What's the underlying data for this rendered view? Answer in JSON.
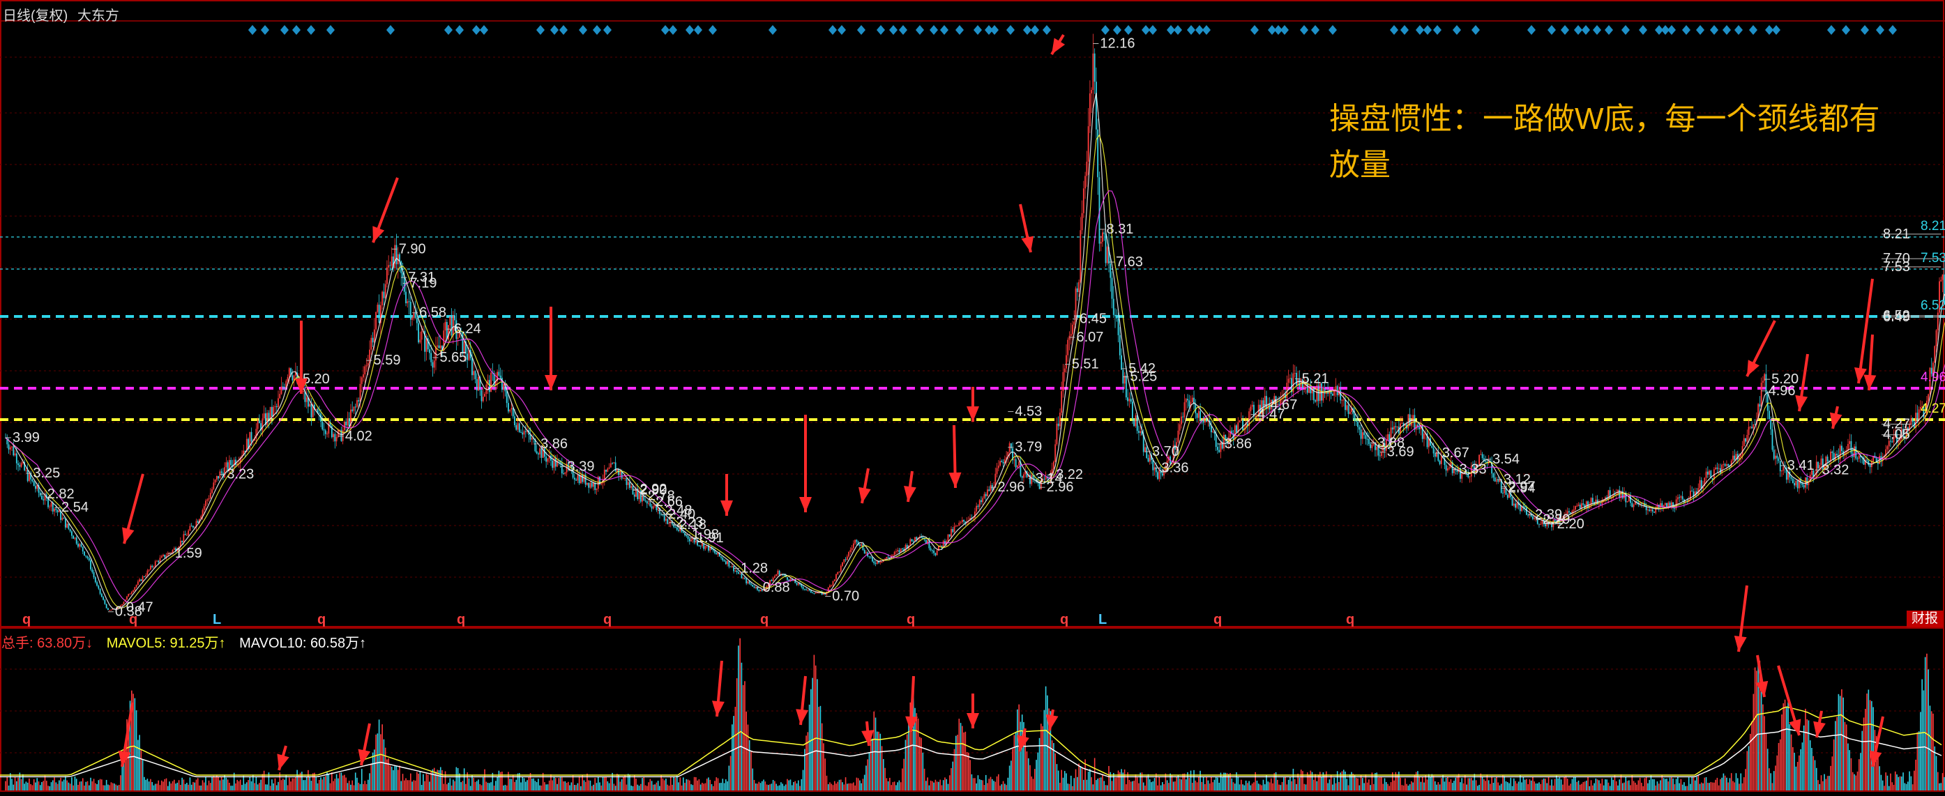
{
  "header": {
    "title": "日线(复权)",
    "stock_name": "大东方"
  },
  "annotation": {
    "line1": "操盘惯性：一路做W底，每一个颈线都有",
    "line2": "放量"
  },
  "volume_legend": {
    "total": "总手: 63.80万↓",
    "mavol5": "MAVOL5: 91.25万↑",
    "mavol10": "MAVOL10: 60.58万↑"
  },
  "caibao_label": "财报",
  "colors": {
    "up": "#ff3b3b",
    "down": "#32d2e6",
    "neck_cyan": "#30d5e8",
    "neck_magenta": "#ff27ff",
    "neck_yellow": "#ffff33",
    "signal_diamond": "#1e90c8",
    "annotation": "#f5b400",
    "arrow": "#ff2a2a"
  },
  "chart_data": [
    {
      "type": "candlestick",
      "title": "日线(复权) 大东方",
      "ylim": [
        0,
        13
      ],
      "close_path": [
        [
          0,
          3.99
        ],
        [
          12,
          3.3
        ],
        [
          22,
          2.8
        ],
        [
          32,
          2.5
        ],
        [
          42,
          2.0
        ],
        [
          52,
          1.5
        ],
        [
          58,
          0.9
        ],
        [
          65,
          0.4
        ],
        [
          72,
          0.47
        ],
        [
          82,
          0.9
        ],
        [
          95,
          1.4
        ],
        [
          108,
          1.7
        ],
        [
          122,
          2.3
        ],
        [
          135,
          3.2
        ],
        [
          148,
          3.6
        ],
        [
          160,
          4.2
        ],
        [
          172,
          4.6
        ],
        [
          180,
          5.5
        ],
        [
          188,
          4.9
        ],
        [
          195,
          4.5
        ],
        [
          204,
          4.2
        ],
        [
          212,
          4.0
        ],
        [
          222,
          4.6
        ],
        [
          232,
          6.0
        ],
        [
          240,
          7.0
        ],
        [
          245,
          7.9
        ],
        [
          252,
          7.2
        ],
        [
          262,
          6.2
        ],
        [
          272,
          5.6
        ],
        [
          282,
          6.4
        ],
        [
          292,
          5.8
        ],
        [
          302,
          4.9
        ],
        [
          312,
          5.3
        ],
        [
          322,
          4.4
        ],
        [
          332,
          4.0
        ],
        [
          342,
          3.6
        ],
        [
          352,
          3.4
        ],
        [
          362,
          3.2
        ],
        [
          374,
          3.0
        ],
        [
          386,
          3.4
        ],
        [
          398,
          2.9
        ],
        [
          410,
          2.6
        ],
        [
          422,
          2.2
        ],
        [
          434,
          1.9
        ],
        [
          446,
          1.7
        ],
        [
          458,
          1.4
        ],
        [
          470,
          1.0
        ],
        [
          480,
          0.8
        ],
        [
          490,
          1.2
        ],
        [
          500,
          1.0
        ],
        [
          510,
          0.8
        ],
        [
          520,
          0.75
        ],
        [
          530,
          1.3
        ],
        [
          540,
          1.9
        ],
        [
          550,
          1.4
        ],
        [
          560,
          1.5
        ],
        [
          570,
          1.7
        ],
        [
          580,
          2.0
        ],
        [
          590,
          1.6
        ],
        [
          602,
          2.1
        ],
        [
          614,
          2.4
        ],
        [
          626,
          3.0
        ],
        [
          636,
          3.8
        ],
        [
          646,
          3.2
        ],
        [
          656,
          3.0
        ],
        [
          664,
          3.3
        ],
        [
          672,
          5.5
        ],
        [
          680,
          7.0
        ],
        [
          686,
          10.0
        ],
        [
          690,
          12.16
        ],
        [
          694,
          8.3
        ],
        [
          700,
          7.6
        ],
        [
          708,
          5.4
        ],
        [
          716,
          4.4
        ],
        [
          724,
          3.6
        ],
        [
          732,
          3.2
        ],
        [
          740,
          3.6
        ],
        [
          750,
          4.8
        ],
        [
          760,
          4.4
        ],
        [
          770,
          3.8
        ],
        [
          782,
          4.2
        ],
        [
          794,
          4.6
        ],
        [
          806,
          4.8
        ],
        [
          818,
          5.2
        ],
        [
          830,
          4.9
        ],
        [
          842,
          5.0
        ],
        [
          852,
          4.6
        ],
        [
          862,
          4.0
        ],
        [
          872,
          3.7
        ],
        [
          882,
          4.2
        ],
        [
          892,
          4.4
        ],
        [
          904,
          3.8
        ],
        [
          914,
          3.4
        ],
        [
          926,
          3.2
        ],
        [
          938,
          3.6
        ],
        [
          948,
          3.0
        ],
        [
          958,
          2.6
        ],
        [
          970,
          2.3
        ],
        [
          980,
          2.2
        ],
        [
          990,
          2.4
        ],
        [
          1002,
          2.6
        ],
        [
          1012,
          2.7
        ],
        [
          1022,
          2.9
        ],
        [
          1034,
          2.6
        ],
        [
          1046,
          2.5
        ],
        [
          1058,
          2.6
        ],
        [
          1070,
          2.8
        ],
        [
          1080,
          3.2
        ],
        [
          1092,
          3.4
        ],
        [
          1102,
          3.8
        ],
        [
          1110,
          4.4
        ],
        [
          1116,
          5.2
        ],
        [
          1122,
          3.6
        ],
        [
          1130,
          3.2
        ],
        [
          1140,
          3.0
        ],
        [
          1150,
          3.4
        ],
        [
          1160,
          3.6
        ],
        [
          1170,
          3.8
        ],
        [
          1180,
          3.4
        ],
        [
          1190,
          3.6
        ],
        [
          1200,
          4.0
        ],
        [
          1210,
          4.3
        ],
        [
          1218,
          4.6
        ],
        [
          1224,
          6.0
        ],
        [
          1228,
          7.5
        ],
        [
          1232,
          6.2
        ]
      ],
      "price_labels": [
        "3.99",
        "3.25",
        "2.82",
        "2.54",
        "0.38",
        "0.47",
        "1.59",
        "3.23",
        "5.59",
        "7.90",
        "7.31",
        "7.19",
        "6.58",
        "6.24",
        "5.65",
        "5.20",
        "4.02",
        "3.86",
        "3.39",
        "2.92",
        "2.66",
        "2.23",
        "1.91",
        "0.88",
        "1.98",
        "0.70",
        "2.90",
        "2.40",
        "1.28",
        "2.48",
        "2.18",
        "2.78",
        "4.53",
        "3.79",
        "3.22",
        "2.96",
        "12.16",
        "8.31",
        "7.63",
        "6.45",
        "6.07",
        "5.51",
        "5.42",
        "4.67",
        "3.36",
        "3.14",
        "2.96",
        "3.88",
        "3.70",
        "5.25",
        "5.21",
        "4.47",
        "3.69",
        "3.86",
        "3.67",
        "3.33",
        "2.97",
        "2.20",
        "2.29",
        "3.54",
        "2.94",
        "2.39",
        "5.20",
        "3.12",
        "3.41",
        "3.32",
        "4.05",
        "7.70",
        "8.21",
        "7.53",
        "6.52",
        "6.49",
        "4.96",
        "4.27"
      ],
      "right_axis_labels": [
        "8.21",
        "7.53",
        "6.52",
        "4.96",
        "4.27"
      ],
      "neckline_levels": [
        8.21,
        7.53,
        6.52,
        4.96,
        4.27
      ],
      "event_markers": [
        "q",
        "q",
        "L",
        "q",
        "q",
        "q",
        "q",
        "q",
        "q",
        "L",
        "q",
        "q"
      ]
    },
    {
      "type": "bar",
      "title": "总手",
      "series": [
        {
          "name": "总手",
          "values": [
            63.8
          ]
        },
        {
          "name": "MAVOL5",
          "values": [
            91.25
          ]
        },
        {
          "name": "MAVOL10",
          "values": [
            60.58
          ]
        }
      ]
    }
  ]
}
